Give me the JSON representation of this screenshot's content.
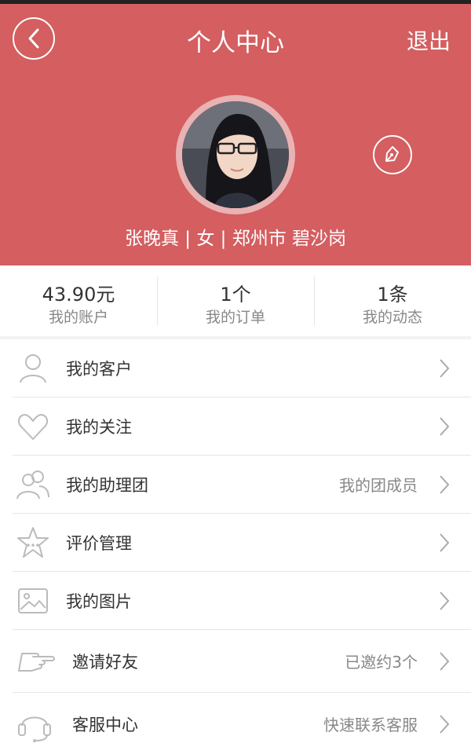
{
  "header": {
    "title": "个人中心",
    "logout_label": "退出",
    "bg_color": "#d45e60"
  },
  "profile": {
    "line": "张晚真 | 女 | 郑州市 碧沙岗"
  },
  "stats": [
    {
      "value": "43.90元",
      "label": "我的账户"
    },
    {
      "value": "1个",
      "label": "我的订单"
    },
    {
      "value": "1条",
      "label": "我的动态"
    }
  ],
  "menu": [
    {
      "label": "我的客户",
      "extra": "",
      "icon": "user-icon"
    },
    {
      "label": "我的关注",
      "extra": "",
      "icon": "heart-icon"
    },
    {
      "label": "我的助理团",
      "extra": "我的团成员",
      "icon": "group-icon"
    },
    {
      "label": "评价管理",
      "extra": "",
      "icon": "star-icon"
    },
    {
      "label": "我的图片",
      "extra": "",
      "icon": "picture-icon"
    },
    {
      "label": "邀请好友",
      "extra": "已邀约3个",
      "icon": "hand-icon"
    },
    {
      "label": "客服中心",
      "extra": "快速联系客服",
      "icon": "headset-icon"
    }
  ]
}
